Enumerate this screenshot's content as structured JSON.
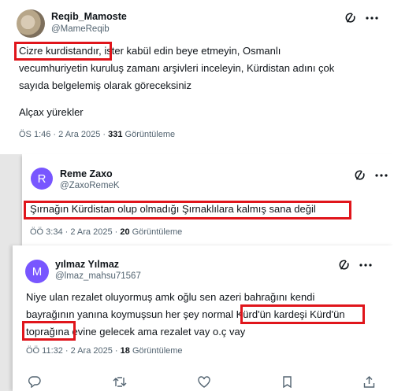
{
  "posts": [
    {
      "display_name": "Reqib_Mamoste",
      "handle": "@MameReqib",
      "lines": [
        "Cizre kurdistandır, ister kabül edin beye etmeyin, Osmanlı",
        "vecumhuriyetin kuruluş zamanı arşivleri inceleyin, Kürdistan adını çok",
        "sayıda belgelemiş olarak göreceksiniz",
        "Alçax yürekler"
      ],
      "time": "ÖS 1:46 · 2 Ara 2025 · ",
      "views_count": "331",
      "views_label": " Görüntüleme"
    },
    {
      "avatar_letter": "R",
      "avatar_color": "#7856ff",
      "display_name": "Reme Zaxo",
      "handle": "@ZaxoRemeK",
      "lines": [
        "Şırnağın Kürdistan olup olmadığı Şırnaklılara kalmış sana değil"
      ],
      "time": "ÖÖ 3:34 · 2 Ara 2025 · ",
      "views_count": "20",
      "views_label": " Görüntüleme"
    },
    {
      "avatar_letter": "M",
      "avatar_color": "#7856ff",
      "display_name": "yılmaz Yılmaz",
      "handle": "@lmaz_mahsu71567",
      "lines": [
        "Niye ulan rezalet oluyormuş amk oğlu sen azeri bahrağını kendi",
        "bayrağının yanına koymuşsun her şey normal Kürd'ün kardeşi Kürd'ün",
        "toprağına evine gelecek ama rezalet vay o.ç vay"
      ],
      "time": "ÖÖ 11:32 · 2 Ara 2025 · ",
      "views_count": "18",
      "views_label": " Görüntüleme"
    }
  ],
  "icon_names": [
    "grok-icon",
    "more-icon",
    "reply-icon",
    "repost-icon",
    "like-icon",
    "bookmark-icon",
    "share-icon"
  ],
  "colors": {
    "highlight": "#e0151b",
    "avatar": "#7856ff",
    "secondary_text": "#536471"
  }
}
